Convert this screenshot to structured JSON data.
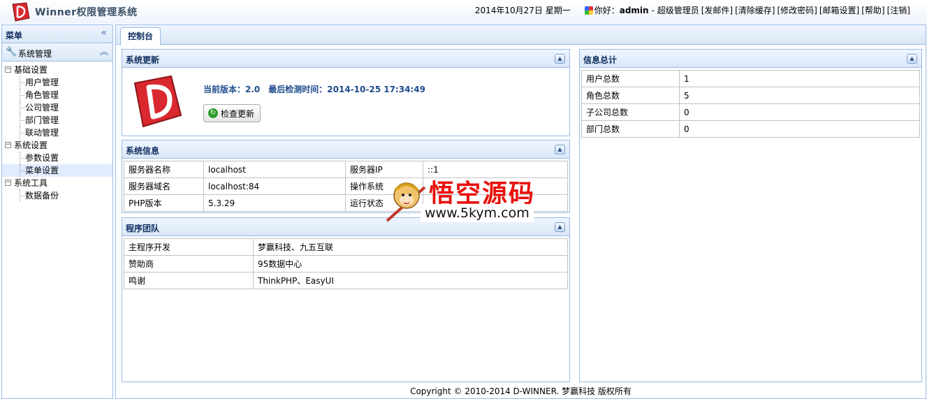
{
  "header": {
    "app_title": "Winner权限管理系统",
    "date": "2014年10月27日 星期一",
    "greeting_prefix": "你好：",
    "username": "admin",
    "role": "- 超级管理员",
    "links": [
      "[发邮件]",
      "[清除缓存]",
      "[修改密码]",
      "[邮箱设置]",
      "[帮助]",
      "[注销]"
    ]
  },
  "sidebar": {
    "title": "菜单",
    "section": "系统管理",
    "tree": [
      {
        "label": "基础设置",
        "level": 0
      },
      {
        "label": "用户管理",
        "level": 1
      },
      {
        "label": "角色管理",
        "level": 1
      },
      {
        "label": "公司管理",
        "level": 1
      },
      {
        "label": "部门管理",
        "level": 1
      },
      {
        "label": "联动管理",
        "level": 1
      },
      {
        "label": "系统设置",
        "level": 0
      },
      {
        "label": "参数设置",
        "level": 1
      },
      {
        "label": "菜单设置",
        "level": 1,
        "selected": true
      },
      {
        "label": "系统工具",
        "level": 0
      },
      {
        "label": "数据备份",
        "level": 1
      }
    ]
  },
  "tabs": [
    {
      "label": "控制台",
      "active": true
    }
  ],
  "update_panel": {
    "title": "系统更新",
    "version_label": "当前版本：2.0",
    "checked_label": "最后检测时间：",
    "checked_time": "2014-10-25 17:34:49",
    "check_button": "检查更新"
  },
  "system_panel": {
    "title": "系统信息",
    "rows": [
      [
        "服务器名称",
        "localhost",
        "服务器IP",
        "::1"
      ],
      [
        "服务器域名",
        "localhost:84",
        "操作系统",
        ""
      ],
      [
        "PHP版本",
        "5.3.29",
        "运行状态",
        ""
      ]
    ]
  },
  "team_panel": {
    "title": "程序团队",
    "rows": [
      [
        "主程序开发",
        "梦赢科技、九五互联"
      ],
      [
        "赞助商",
        "95数据中心"
      ],
      [
        "鸣谢",
        "ThinkPHP、EasyUI"
      ]
    ]
  },
  "stats_panel": {
    "title": "信息总计",
    "rows": [
      [
        "用户总数",
        "1"
      ],
      [
        "角色总数",
        "5"
      ],
      [
        "子公司总数",
        "0"
      ],
      [
        "部门总数",
        "0"
      ]
    ]
  },
  "watermark": {
    "title": "悟空源码",
    "url": "www.5kym.com"
  },
  "footer": "Copyright © 2010-2014 D-WINNER. 梦赢科技 版权所有",
  "colors": {
    "panel_border": "#99bbe8",
    "panel_title": "#0e2d5f",
    "accent_red": "#d9282f",
    "watermark_red": "#e8100c"
  }
}
